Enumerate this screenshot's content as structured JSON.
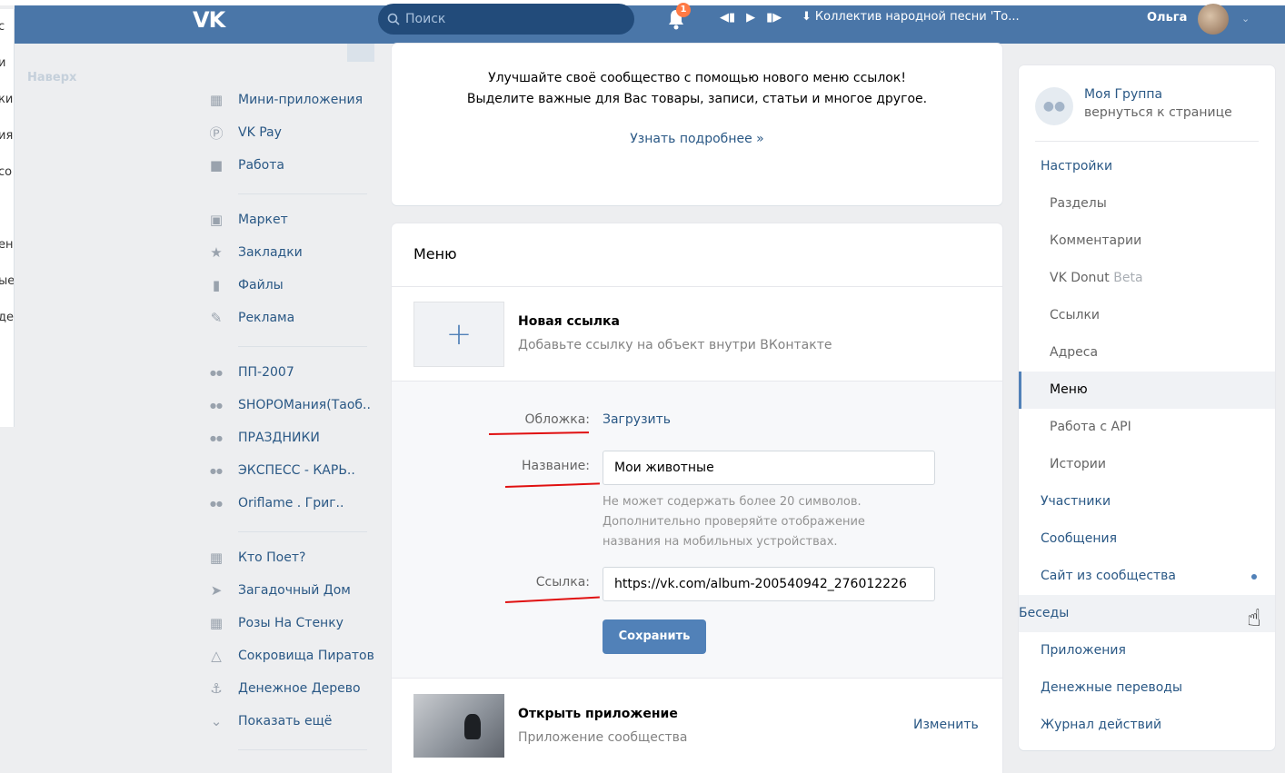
{
  "header": {
    "search_placeholder": "Поиск",
    "notif_count": "1",
    "track": "Коллектив народной песни 'То...",
    "user_name": "Ольга",
    "brand_color": "#4a76a8"
  },
  "left_fragment": [
    "с",
    "и",
    "ки",
    "ия",
    "со",
    "",
    "ени",
    "ые",
    "де"
  ],
  "naverkh": "Наверх",
  "nav": {
    "items": [
      {
        "label": "Мини-приложения",
        "icon": "apps-icon"
      },
      {
        "label": "VK Pay",
        "icon": "vkpay-icon"
      },
      {
        "label": "Работа",
        "icon": "briefcase-icon"
      },
      {
        "label": "Маркет",
        "icon": "shopping-bag-icon"
      },
      {
        "label": "Закладки",
        "icon": "star-icon"
      },
      {
        "label": "Файлы",
        "icon": "file-icon"
      },
      {
        "label": "Реклама",
        "icon": "megaphone-icon"
      },
      {
        "label": "ПП-2007",
        "icon": "group-icon"
      },
      {
        "label": "SHOPОМания(Таоб..",
        "icon": "group-icon"
      },
      {
        "label": "ПРАЗДНИКИ",
        "icon": "group-icon"
      },
      {
        "label": "ЭКСПЕСС - КАРЬ..",
        "icon": "group-icon"
      },
      {
        "label": "Oriflame . Григ..",
        "icon": "group-icon"
      },
      {
        "label": "Кто Поет?",
        "icon": "apps-icon"
      },
      {
        "label": "Загадочный Дом",
        "icon": "rocket-icon"
      },
      {
        "label": "Розы На Стенку",
        "icon": "apps-icon"
      },
      {
        "label": "Сокровища Пиратов",
        "icon": "flask-icon"
      },
      {
        "label": "Денежное Дерево",
        "icon": "anchor-icon"
      },
      {
        "label": "Показать ещё",
        "icon": "chevron-down-icon"
      }
    ]
  },
  "info": {
    "line1": "Улучшайте своё сообщество с помощью нового меню ссылок!",
    "line2": "Выделите важные для Вас товары, записи, статьи и многое другое.",
    "learn_more": "Узнать подробнее »"
  },
  "menu": {
    "title": "Меню",
    "new_link_title": "Новая ссылка",
    "new_link_sub": "Добавьте ссылку на объект внутри ВКонтакте",
    "cover_label": "Обложка:",
    "cover_action": "Загрузить",
    "name_label": "Название:",
    "name_value": "Мои животные",
    "hint1": "Не может содержать более 20 символов.",
    "hint2": "Дополнительно проверяйте отображение",
    "hint3": "названия на мобильных устройствах.",
    "link_label": "Ссылка:",
    "link_value": "https://vk.com/album-200540942_276012226",
    "save_label": "Сохранить",
    "app_title": "Открыть приложение",
    "app_sub": "Приложение сообщества",
    "edit_label": "Изменить"
  },
  "settings": {
    "group_name": "Моя Группа",
    "group_back": "вернуться к странице",
    "items": [
      {
        "label": "Настройки",
        "kind": "top"
      },
      {
        "label": "Разделы",
        "kind": "sub"
      },
      {
        "label": "Комментарии",
        "kind": "sub"
      },
      {
        "label": "VK Donut",
        "kind": "sub",
        "extra": "Beta"
      },
      {
        "label": "Ссылки",
        "kind": "sub"
      },
      {
        "label": "Адреса",
        "kind": "sub"
      },
      {
        "label": "Меню",
        "kind": "active"
      },
      {
        "label": "Работа с API",
        "kind": "sub"
      },
      {
        "label": "Истории",
        "kind": "sub"
      },
      {
        "label": "Участники",
        "kind": "top"
      },
      {
        "label": "Сообщения",
        "kind": "top"
      },
      {
        "label": "Сайт из сообщества",
        "kind": "top",
        "dot": true
      },
      {
        "label": "Беседы",
        "kind": "hover"
      },
      {
        "label": "Приложения",
        "kind": "top"
      },
      {
        "label": "Денежные переводы",
        "kind": "top"
      },
      {
        "label": "Журнал действий",
        "kind": "top"
      }
    ]
  }
}
